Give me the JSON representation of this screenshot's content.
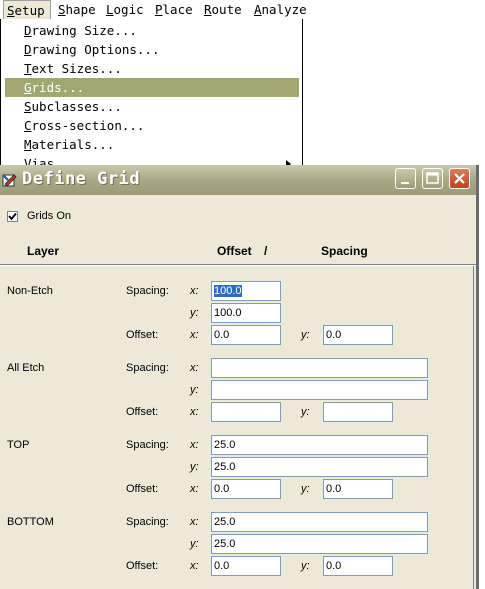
{
  "menubar": {
    "items": [
      {
        "label": "Setup",
        "accel": "S"
      },
      {
        "label": "Shape",
        "accel": "S"
      },
      {
        "label": "Logic",
        "accel": "L"
      },
      {
        "label": "Place",
        "accel": "P"
      },
      {
        "label": "Route",
        "accel": "R"
      },
      {
        "label": "Analyze",
        "accel": "A"
      }
    ]
  },
  "setup_menu": {
    "items": [
      {
        "label": "Drawing Size..."
      },
      {
        "label": "Drawing Options..."
      },
      {
        "label": "Text Sizes..."
      },
      {
        "label": "Grids..."
      },
      {
        "label": "Subclasses..."
      },
      {
        "label": "Cross-section..."
      },
      {
        "label": "Materials..."
      },
      {
        "label": "Vias"
      }
    ]
  },
  "dialog": {
    "title": "Define Grid",
    "grids_on_label": "Grids On",
    "grids_on_checked": true,
    "header": {
      "layer": "Layer",
      "offset": "Offset",
      "slash": "/",
      "spacing": "Spacing"
    },
    "spacing_label": "Spacing:",
    "offset_label": "Offset:",
    "x_label": "x:",
    "y_label": "y:",
    "layers": [
      {
        "name": "Non-Etch",
        "spacing_x": "100.0",
        "spacing_y": "100.0",
        "offset_x": "0.0",
        "offset_y": "0.0"
      },
      {
        "name": "All Etch",
        "spacing_x": "",
        "spacing_y": "",
        "offset_x": "",
        "offset_y": ""
      },
      {
        "name": "TOP",
        "spacing_x": "25.0",
        "spacing_y": "25.0",
        "offset_x": "0.0",
        "offset_y": "0.0"
      },
      {
        "name": "BOTTOM",
        "spacing_x": "25.0",
        "spacing_y": "25.0",
        "offset_x": "0.0",
        "offset_y": "0.0"
      }
    ]
  }
}
